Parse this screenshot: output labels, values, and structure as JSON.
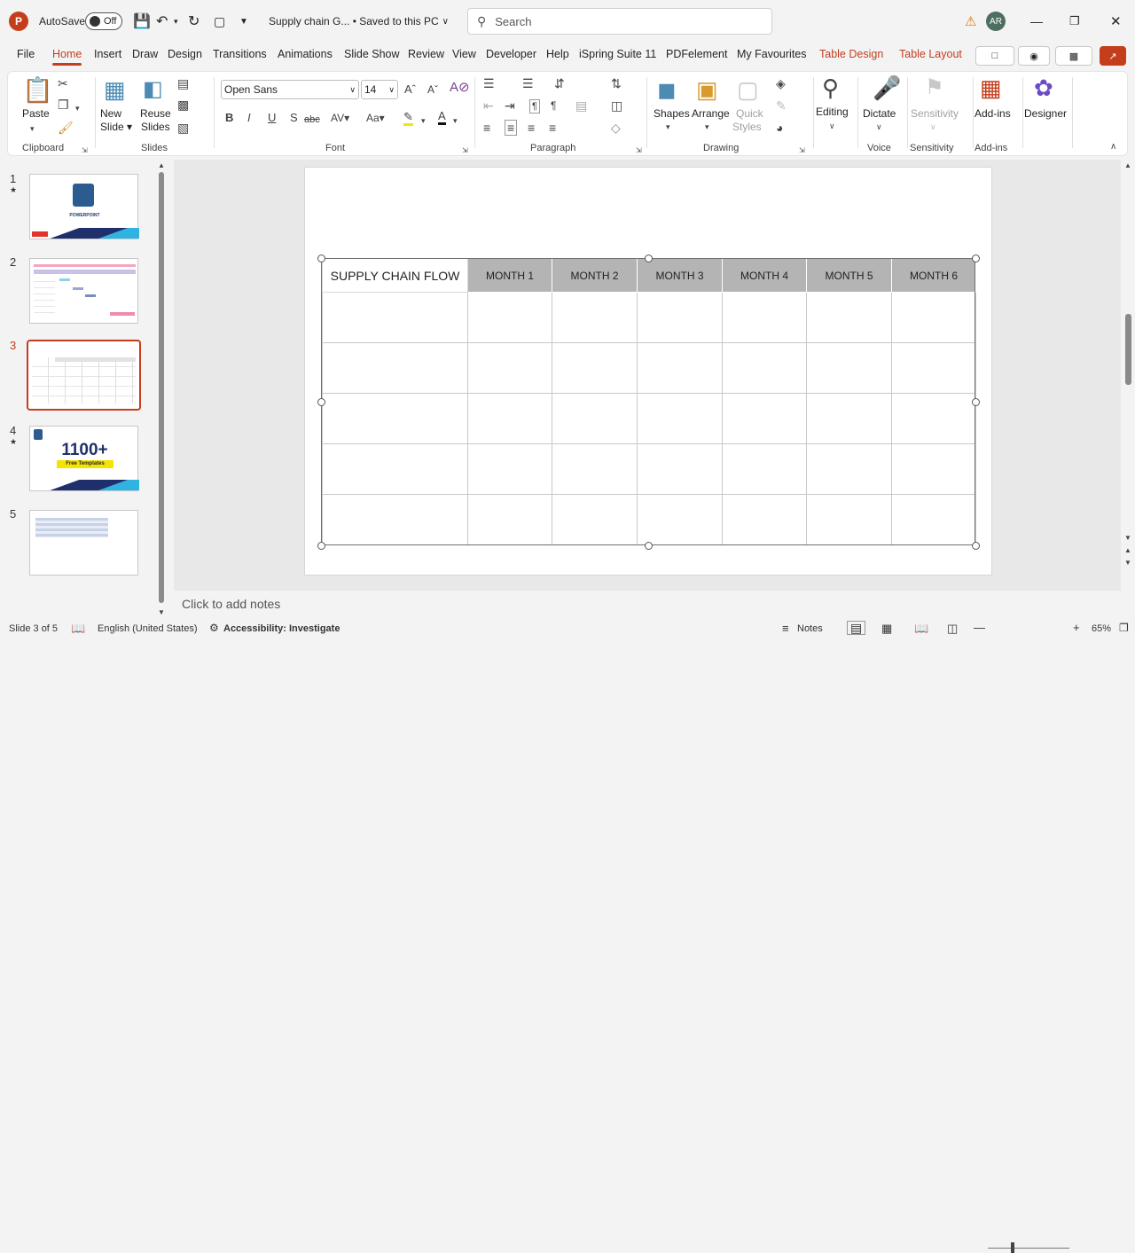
{
  "titlebar": {
    "app_logo": "P",
    "autosave_label": "AutoSave",
    "autosave_state": "Off",
    "document_title": "Supply chain G... • Saved to this PC",
    "search_placeholder": "Search",
    "user_initials": "AR"
  },
  "menu": {
    "tabs": [
      "File",
      "Home",
      "Insert",
      "Draw",
      "Design",
      "Transitions",
      "Animations",
      "Slide Show",
      "Review",
      "View",
      "Developer",
      "Help",
      "iSpring Suite 11",
      "PDFelement",
      "My Favourites",
      "Table Design",
      "Table Layout"
    ],
    "active_tab": "Home"
  },
  "ribbon": {
    "clipboard": {
      "paste": "Paste",
      "group": "Clipboard"
    },
    "slides": {
      "new_slide": "New Slide",
      "new_slide_line1": "New",
      "new_slide_line2": "Slide",
      "reuse_line1": "Reuse",
      "reuse_line2": "Slides",
      "group": "Slides"
    },
    "font": {
      "family": "Open Sans",
      "size": "14",
      "group": "Font",
      "bold": "B",
      "italic": "I",
      "underline": "U",
      "strike": "S",
      "abc": "abc"
    },
    "paragraph": {
      "group": "Paragraph"
    },
    "drawing": {
      "shapes": "Shapes",
      "arrange": "Arrange",
      "quick_line1": "Quick",
      "quick_line2": "Styles",
      "group": "Drawing"
    },
    "editing": {
      "label": "Editing"
    },
    "voice": {
      "dictate": "Dictate",
      "group": "Voice"
    },
    "sensitivity": {
      "label": "Sensitivity",
      "group": "Sensitivity"
    },
    "addins": {
      "label": "Add-ins",
      "group": "Add-ins"
    },
    "designer": {
      "label": "Designer"
    }
  },
  "thumbnails": [
    {
      "num": "1",
      "star": "★"
    },
    {
      "num": "2",
      "star": ""
    },
    {
      "num": "3",
      "star": ""
    },
    {
      "num": "4",
      "star": "★"
    },
    {
      "num": "5",
      "star": ""
    }
  ],
  "thumb_text": {
    "t1_title": "POWERPOINT",
    "t4_big": "1100+",
    "t4_sub": "Free Templates"
  },
  "table": {
    "headers": [
      "SUPPLY CHAIN FLOW",
      "MONTH 1",
      "MONTH 2",
      "MONTH 3",
      "MONTH 4",
      "MONTH 5",
      "MONTH 6"
    ],
    "row_count": 5
  },
  "notes_placeholder": "Click to add notes",
  "status": {
    "slide_info": "Slide 3 of 5",
    "language": "English (United States)",
    "accessibility": "Accessibility: Investigate",
    "notes": "Notes",
    "zoom": "65%"
  },
  "colors": {
    "accent": "#c43e1c",
    "header_gray": "#b4b4b4"
  }
}
